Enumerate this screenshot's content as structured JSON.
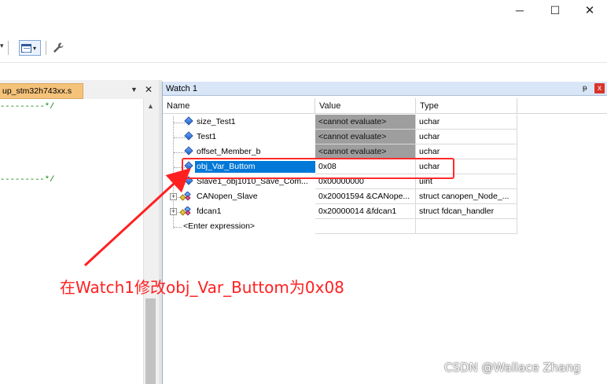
{
  "window_controls": {
    "minimize": "─",
    "maximize": "☐",
    "close": "✕"
  },
  "editor_tab": {
    "label": "up_stm32h743xx.s",
    "dropdown": "▼",
    "close": "✕"
  },
  "editor_lines": [
    {
      "text": "---------*/"
    },
    {
      "text": "---------*/"
    }
  ],
  "watch": {
    "title": "Watch 1",
    "pin": "ᵽ",
    "close": "x",
    "columns": {
      "name": "Name",
      "value": "Value",
      "type": "Type"
    },
    "rows": [
      {
        "name": "size_Test1",
        "value": "<cannot evaluate>",
        "type": "uchar",
        "icon": "variable-icon",
        "gray": true,
        "expand": false,
        "selected": false
      },
      {
        "name": "Test1",
        "value": "<cannot evaluate>",
        "type": "uchar",
        "icon": "variable-icon",
        "gray": true,
        "expand": false,
        "selected": false
      },
      {
        "name": "offset_Member_b",
        "value": "<cannot evaluate>",
        "type": "uchar",
        "icon": "variable-icon",
        "gray": true,
        "expand": false,
        "selected": false
      },
      {
        "name": "obj_Var_Buttom",
        "value": "0x08",
        "type": "uchar",
        "icon": "variable-icon",
        "gray": false,
        "expand": false,
        "selected": true
      },
      {
        "name": "Slave1_obj1010_Save_Com...",
        "value": "0x00000000",
        "type": "uint",
        "icon": "variable-icon",
        "gray": false,
        "expand": false,
        "selected": false
      },
      {
        "name": "CANopen_Slave",
        "value": "0x20001594 &CANope...",
        "type": "struct canopen_Node_...",
        "icon": "struct-icon",
        "gray": false,
        "expand": true,
        "selected": false
      },
      {
        "name": "fdcan1",
        "value": "0x20000014 &fdcan1",
        "type": "struct fdcan_handler",
        "icon": "struct-icon",
        "gray": false,
        "expand": true,
        "selected": false
      }
    ],
    "enter_expression": "<Enter expression>"
  },
  "annotation": {
    "text": "在Watch1修改obj_Var_Buttom为0x08",
    "color": "#ff2020"
  },
  "watermark": "CSDN @Wallace Zhang",
  "colors": {
    "selection": "#0078d7",
    "tab": "#f5c27a",
    "watch_title": "#d9e6f7",
    "annotation": "#ff2020"
  }
}
